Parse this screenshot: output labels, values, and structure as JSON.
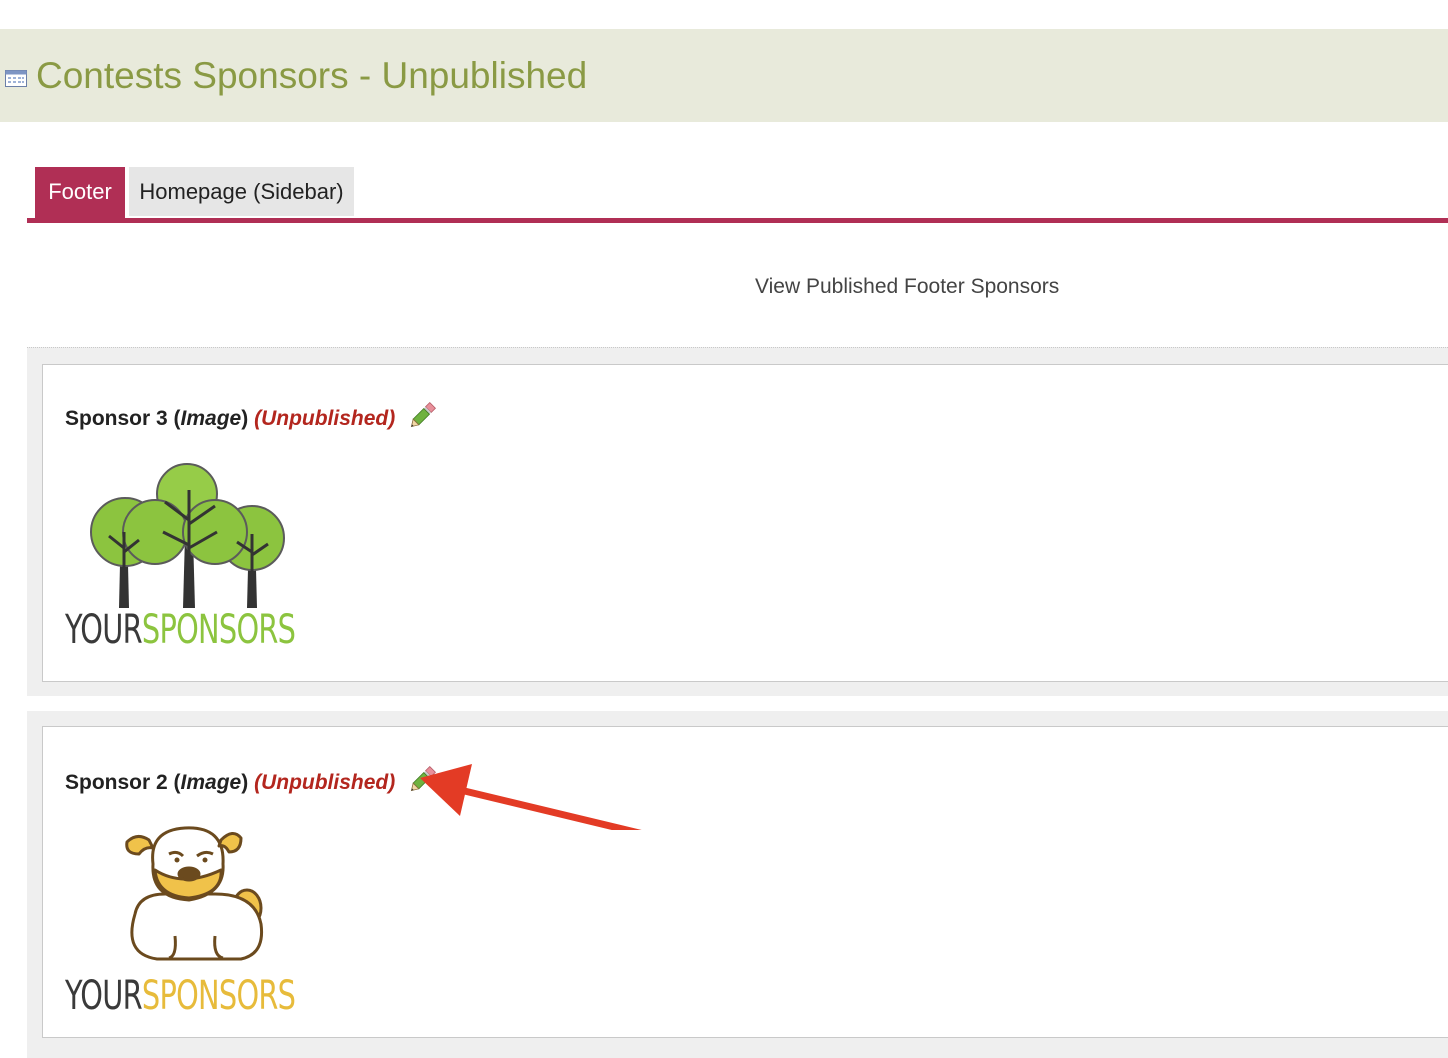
{
  "header": {
    "title": "Contests Sponsors - Unpublished",
    "icon": "calendar-icon"
  },
  "tabs": [
    {
      "label": "Footer",
      "active": true
    },
    {
      "label": "Homepage (Sidebar)",
      "active": false
    }
  ],
  "links": {
    "view_published": "View Published Footer Sponsors"
  },
  "sponsors": [
    {
      "name": "Sponsor 3",
      "type": "Image",
      "status": "(Unpublished)",
      "logo": {
        "icon": "trees-logo",
        "word_dark": "YOUR",
        "word_accent": "SPONSORS"
      }
    },
    {
      "name": "Sponsor 2",
      "type": "Image",
      "status": "(Unpublished)",
      "logo": {
        "icon": "bulldog-logo",
        "word_dark": "YOUR",
        "word_accent": "SPONSORS"
      }
    }
  ],
  "colors": {
    "title": "#8a9a44",
    "title_bar": "#e8eadb",
    "tab_active": "#b02f55",
    "status": "#b3261e",
    "annotation_arrow": "#e33b25"
  }
}
